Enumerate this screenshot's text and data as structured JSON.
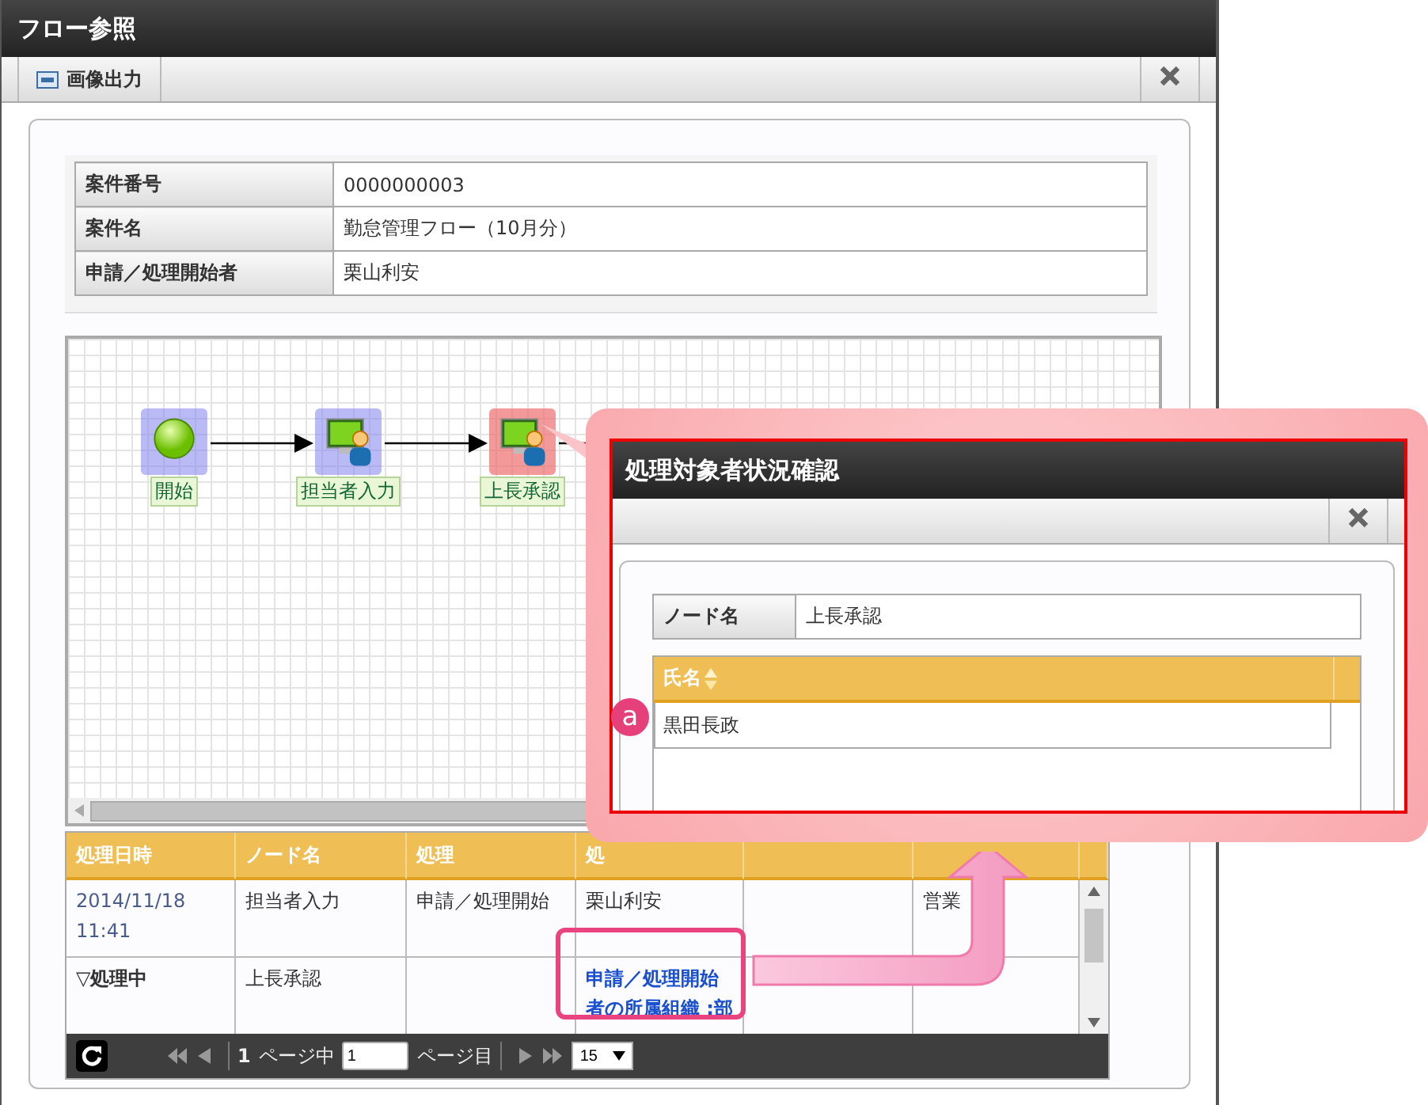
{
  "window": {
    "title": "フロー参照"
  },
  "toolbar": {
    "export_button": "画像出力"
  },
  "case_info": [
    {
      "label": "案件番号",
      "value": "0000000003"
    },
    {
      "label": "案件名",
      "value": "勤怠管理フロー（10月分）"
    },
    {
      "label": "申請／処理開始者",
      "value": "栗山利安"
    }
  ],
  "flow": {
    "nodes": [
      {
        "kind": "start",
        "label": "開始",
        "selected": false
      },
      {
        "kind": "task",
        "label": "担当者入力",
        "selected": false
      },
      {
        "kind": "task",
        "label": "上長承認",
        "selected": true
      }
    ]
  },
  "history": {
    "columns": [
      "処理日時",
      "ノード名",
      "処理",
      "処"
    ],
    "rows": [
      {
        "cells": [
          {
            "kind": "date",
            "text": "2014/11/18\n11:41"
          },
          {
            "kind": "text",
            "text": "担当者入力"
          },
          {
            "kind": "text",
            "text": "申請／処理開始"
          },
          {
            "kind": "text",
            "text": "栗山利安"
          },
          {
            "kind": "empty"
          },
          {
            "kind": "text",
            "text": "営業"
          }
        ]
      },
      {
        "cells": [
          {
            "kind": "status",
            "text": "▽処理中"
          },
          {
            "kind": "text",
            "text": "上長承認"
          },
          {
            "kind": "empty"
          },
          {
            "kind": "link",
            "text": "申請／処理開始者の所属組織 :部"
          },
          {
            "kind": "empty"
          },
          {
            "kind": "empty"
          }
        ]
      }
    ],
    "pager": {
      "current": "1",
      "of_pages": "ページ中",
      "page_input": "1",
      "page_suffix": "ページ目",
      "page_size": "15"
    }
  },
  "popup": {
    "title": "処理対象者状況確認",
    "node_label": "ノード名",
    "node_value": "上長承認",
    "column": "氏名",
    "rows": [
      "黒田長政"
    ],
    "badge": "a"
  }
}
